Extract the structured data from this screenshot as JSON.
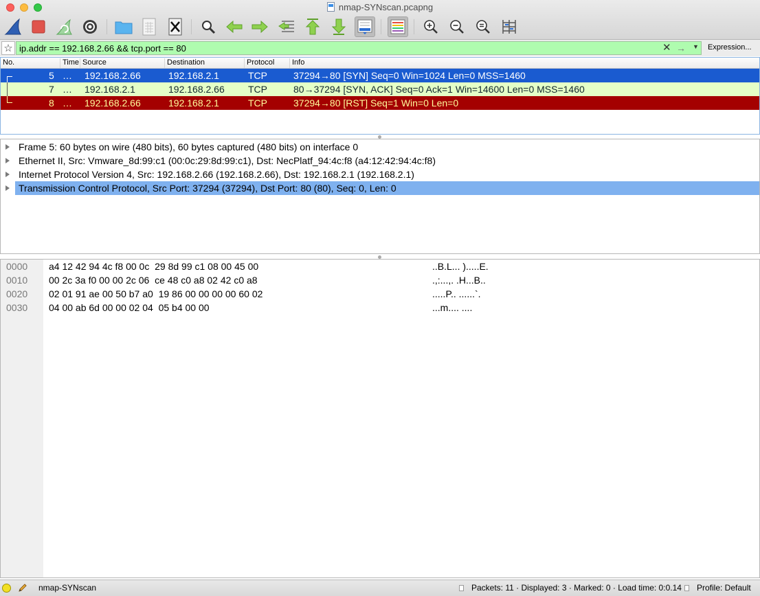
{
  "window": {
    "title": "nmap-SYNscan.pcapng"
  },
  "toolbar": {
    "buttons": [
      "start-capture",
      "stop-capture",
      "restart-capture",
      "capture-options",
      "open-file",
      "save-file",
      "close-file",
      "reload-file",
      "find-packet",
      "go-back",
      "go-forward",
      "go-to-packet",
      "go-first",
      "go-last",
      "autoscroll",
      "colorize",
      "zoom-in",
      "zoom-out",
      "normal-size",
      "resize-columns"
    ]
  },
  "filter": {
    "value": "ip.addr == 192.168.2.66 && tcp.port == 80",
    "expression_label": "Expression..."
  },
  "packet_list": {
    "columns": [
      "No.",
      "Time",
      "Source",
      "Destination",
      "Protocol",
      "Info"
    ],
    "rows": [
      {
        "no": "5",
        "time": "…",
        "source": "192.168.2.66",
        "destination": "192.168.2.1",
        "protocol": "TCP",
        "info": "37294→80 [SYN] Seq=0 Win=1024 Len=0 MSS=1460"
      },
      {
        "no": "7",
        "time": "…",
        "source": "192.168.2.1",
        "destination": "192.168.2.66",
        "protocol": "TCP",
        "info": "80→37294 [SYN, ACK] Seq=0 Ack=1 Win=14600 Len=0 MSS=1460"
      },
      {
        "no": "8",
        "time": "…",
        "source": "192.168.2.66",
        "destination": "192.168.2.1",
        "protocol": "TCP",
        "info": "37294→80 [RST] Seq=1 Win=0 Len=0"
      }
    ]
  },
  "details": [
    "Frame 5: 60 bytes on wire (480 bits), 60 bytes captured (480 bits) on interface 0",
    "Ethernet II, Src: Vmware_8d:99:c1 (00:0c:29:8d:99:c1), Dst: NecPlatf_94:4c:f8 (a4:12:42:94:4c:f8)",
    "Internet Protocol Version 4, Src: 192.168.2.66 (192.168.2.66), Dst: 192.168.2.1 (192.168.2.1)",
    "Transmission Control Protocol, Src Port: 37294 (37294), Dst Port: 80 (80), Seq: 0, Len: 0"
  ],
  "bytes": [
    {
      "offset": "0000",
      "hex": "a4 12 42 94 4c f8 00 0c  29 8d 99 c1 08 00 45 00",
      "ascii": "..B.L... ).....E."
    },
    {
      "offset": "0010",
      "hex": "00 2c 3a f0 00 00 2c 06  ce 48 c0 a8 02 42 c0 a8",
      "ascii": ".,:...,. .H...B.."
    },
    {
      "offset": "0020",
      "hex": "02 01 91 ae 00 50 b7 a0  19 86 00 00 00 00 60 02",
      "ascii": ".....P.. ......`."
    },
    {
      "offset": "0030",
      "hex": "04 00 ab 6d 00 00 02 04  05 b4 00 00",
      "ascii": "...m.... ...."
    }
  ],
  "status": {
    "file": "nmap-SYNscan",
    "packets": "Packets: 11 · Displayed: 3 · Marked: 0 · Load time: 0:0.14",
    "profile": "Profile: Default"
  },
  "colors": {
    "filter_valid": "#affcaf",
    "row_syn": "#1a5bd0",
    "row_synack": "#e4ffc7",
    "row_rst": "#a40000",
    "detail_selected": "#7fb1ef"
  }
}
